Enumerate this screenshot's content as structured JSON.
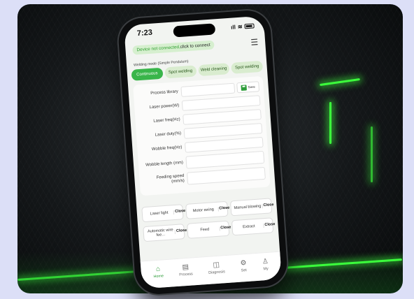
{
  "status_bar": {
    "time": "7:23",
    "signal": "ıll",
    "wifi": "≋"
  },
  "header": {
    "connect_warning": "Device not connected,",
    "connect_action": "click to connect",
    "menu_icon": "list-menu-icon"
  },
  "welding_mode_label": "Welding mode (Simple Pendulum)",
  "tabs": [
    {
      "label": "Continuous",
      "active": true
    },
    {
      "label": "Spot welding",
      "active": false
    },
    {
      "label": "Weld cleaning",
      "active": false
    },
    {
      "label": "Spot welding",
      "active": false
    }
  ],
  "form": {
    "process_library": "Process library",
    "save_label": "Save",
    "fields": [
      {
        "label": "Laser power(W)"
      },
      {
        "label": "Laser freq(Hz)"
      },
      {
        "label": "Laser duty(%)"
      },
      {
        "label": "Wobble freq(Hz)"
      },
      {
        "label": "Wobble length (mm)"
      },
      {
        "label": "Feeding speed (mm/s)"
      }
    ]
  },
  "controls": [
    {
      "label": "Laser light",
      "state": "Close"
    },
    {
      "label": "Motor swing",
      "state": "Close"
    },
    {
      "label": "Manual blowing",
      "state": "Close"
    },
    {
      "label": "Automatic wire fee...",
      "state": "Close"
    },
    {
      "label": "Feed",
      "state": "Close"
    },
    {
      "label": "Extract",
      "state": "Close"
    }
  ],
  "nav": [
    {
      "label": "Home",
      "icon": "home-icon",
      "glyph": "⌂",
      "active": true
    },
    {
      "label": "Process",
      "icon": "process-icon",
      "glyph": "▤",
      "active": false
    },
    {
      "label": "Diagnosis",
      "icon": "diagnosis-icon",
      "glyph": "◫",
      "active": false
    },
    {
      "label": "Set",
      "icon": "settings-gear-icon",
      "glyph": "⚙",
      "active": false
    },
    {
      "label": "My",
      "icon": "user-icon",
      "glyph": "♙",
      "active": false
    }
  ],
  "colors": {
    "accent": "#39b54a",
    "tab_bg": "#d9eccf",
    "pill_bg": "#d6efcf",
    "backdrop": "#dcdff7"
  }
}
